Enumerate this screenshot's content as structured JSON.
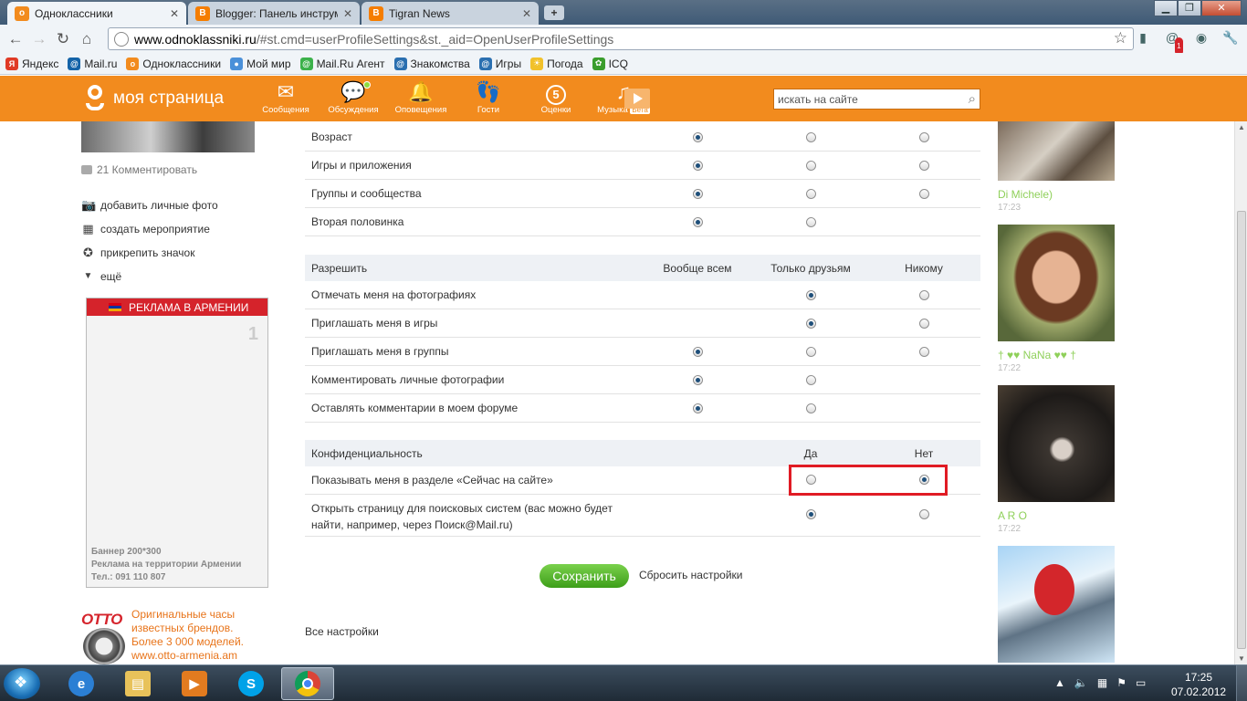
{
  "browser": {
    "tabs": [
      {
        "title": "Одноклассники",
        "active": true
      },
      {
        "title": "Blogger: Панель инструме",
        "active": false
      },
      {
        "title": "Tigran News",
        "active": false
      }
    ],
    "url_host": "www.odnoklassniki.ru",
    "url_path": "/#st.cmd=userProfileSettings&st._aid=OpenUserProfileSettings",
    "bookmarks": [
      "Яндекс",
      "Mail.ru",
      "Одноклассники",
      "Мой мир",
      "Mail.Ru Агент",
      "Знакомства",
      "Игры",
      "Погода",
      "ICQ"
    ],
    "mail_badge": "1"
  },
  "ok_header": {
    "logo_text": "моя страница",
    "nav": [
      {
        "label": "Сообщения",
        "icon": "envelope-icon"
      },
      {
        "label": "Обсуждения",
        "icon": "chat-bubbles-icon"
      },
      {
        "label": "Оповещения",
        "icon": "bell-icon"
      },
      {
        "label": "Гости",
        "icon": "footprints-icon"
      },
      {
        "label": "Оценки",
        "icon": "rating-icon",
        "badge": "5"
      },
      {
        "label": "Музыка",
        "icon": "music-note-icon",
        "tag": "Бета"
      }
    ],
    "search_placeholder": "искать на сайте"
  },
  "left": {
    "comments": "21 Комментировать",
    "menu": [
      {
        "label": "добавить личные фото",
        "icon": "camera-icon"
      },
      {
        "label": "создать мероприятие",
        "icon": "calendar-icon"
      },
      {
        "label": "прикрепить значок",
        "icon": "star-badge-icon"
      },
      {
        "label": "ещё",
        "icon": "triangle-down-icon"
      }
    ],
    "ad": {
      "header": "РЕКЛАМА В АРМЕНИИ",
      "slot_number": "1",
      "line1": "Баннер 200*300",
      "line2": "Реклама на территории Армении",
      "line3": "Тел.: 091 110 807"
    },
    "otto": {
      "logo": "OTTO",
      "line1": "Оригинальные часы",
      "line2": "известных брендов.",
      "line3": "Более 3 000 моделей.",
      "line4": "www.otto-armenia.am"
    }
  },
  "settings": {
    "show_rows": [
      {
        "label": "Возраст",
        "all": true,
        "friends": false,
        "nobody": false,
        "has_nobody": true
      },
      {
        "label": "Игры и приложения",
        "all": true,
        "friends": false,
        "nobody": false,
        "has_nobody": true
      },
      {
        "label": "Группы и сообщества",
        "all": true,
        "friends": false,
        "nobody": false,
        "has_nobody": true
      },
      {
        "label": "Вторая половинка",
        "all": true,
        "friends": false,
        "nobody": false,
        "has_nobody": false
      }
    ],
    "allow_header": {
      "title": "Разрешить",
      "col_all": "Вообще всем",
      "col_friends": "Только друзьям",
      "col_nobody": "Никому"
    },
    "allow_rows": [
      {
        "label": "Отмечать меня на фотографиях",
        "has_all": false,
        "all": false,
        "friends": true,
        "nobody": false,
        "has_nobody": true
      },
      {
        "label": "Приглашать меня в игры",
        "has_all": false,
        "all": false,
        "friends": true,
        "nobody": false,
        "has_nobody": true
      },
      {
        "label": "Приглашать меня в группы",
        "has_all": true,
        "all": true,
        "friends": false,
        "nobody": false,
        "has_nobody": true
      },
      {
        "label": "Комментировать личные фотографии",
        "has_all": true,
        "all": true,
        "friends": false,
        "nobody": false,
        "has_nobody": false
      },
      {
        "label": "Оставлять комментарии в моем форуме",
        "has_all": true,
        "all": true,
        "friends": false,
        "nobody": false,
        "has_nobody": false
      }
    ],
    "privacy_header": {
      "title": "Конфиденциальность",
      "col_yes": "Да",
      "col_no": "Нет"
    },
    "privacy_rows": [
      {
        "label": "Показывать меня в разделе «Сейчас на сайте»",
        "label2": "",
        "yes": false,
        "no": true
      },
      {
        "label": "Открыть страницу для поисковых систем (вас можно будет",
        "label2": "найти, например, через Поиск@Mail.ru)",
        "yes": true,
        "no": false
      }
    ],
    "save": "Сохранить",
    "reset": "Сбросить настройки",
    "all_settings": "Все настройки"
  },
  "guests": [
    {
      "name": "Di Michele)",
      "time": "17:23"
    },
    {
      "name": "† ♥♥ NaNa ♥♥ †",
      "time": "17:22"
    },
    {
      "name": "A R O",
      "time": "17:22"
    },
    {
      "name": "",
      "time": ""
    }
  ],
  "taskbar": {
    "time": "17:25",
    "date": "07.02.2012"
  },
  "colors": {
    "ok_orange": "#f28b1e",
    "save_green": "#4caf25",
    "highlight_red": "#e01b24",
    "guest_name_green": "#8fd05a"
  }
}
